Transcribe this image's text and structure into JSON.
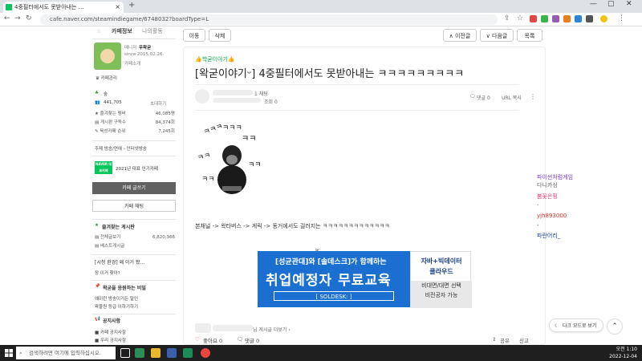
{
  "browser": {
    "tab_title": "4중필터에서도 못받아내는 ...",
    "new_tab": "+",
    "url": "cafe.naver.com/steamindiegame/6748032?boardType=L"
  },
  "sidebar": {
    "tab_info": "카페정보",
    "tab_activity": "나의활동",
    "manager_label": "매니저",
    "manager_name": "우왁굳",
    "since": "since 2015.02.26.",
    "intro": "카페소개",
    "ranks": "♛ 카페관리",
    "grade": "숲",
    "members": "441,705",
    "invite": "초대하기",
    "stats": [
      {
        "label": "★ 즐겨찾는 멤버",
        "value": "46,085명"
      },
      {
        "label": "▤ 게시판 구독수",
        "value": "84,374회"
      },
      {
        "label": "✎ 육성카페 순위",
        "value": "7,245회"
      }
    ],
    "topic": "주제  방송/연예 › 인터넷방송",
    "naver_badge": "NAVER 대표카페",
    "badge_text": "2021년 대표 인기카페",
    "write_btn": "카페 글쓰기",
    "chat_btn": "카페 채팅",
    "fav_head": "즐겨찾는 게시판",
    "fav_items": [
      {
        "label": "전체글보기",
        "value": "6,820,366"
      },
      {
        "label": "베스트게시글",
        "value": ""
      }
    ],
    "section1": "[시청 환경] 왜 이거 봤...",
    "section1_item": "장 이거 찾아?",
    "section2": "왁굳을 응원하는 비밀",
    "section2_items": [
      "왜이런 방송이거든 말인",
      "왁물원 등급 이하기하기"
    ],
    "notice_head": "공지사항",
    "notice_items": [
      "■ 카페 공지사항",
      "■ 우리 공지사항"
    ]
  },
  "main": {
    "btn_move": "이동",
    "btn_delete": "삭제",
    "btn_prev": "∧ 이전글",
    "btn_next": "∨ 다음글",
    "btn_list": "목록",
    "board_name": "👍학굳이야기👍",
    "title": "[왁굳이야기ᵕ] 4중필터에서도 못받아내는 ㅋㅋㅋㅋㅋㅋㅋㅋㅋ",
    "author_suffix": "1 채팅",
    "views": "조회 0",
    "comments": "댓글 0",
    "url_copy": "URL 복사",
    "body": "본채널 -> 왁타버스 -> 게릭 -> 동거에서도 걸러지는 ㅋㅋㅋㅋㅋㅋㅋㅋㅋㅋㅋㅋㅋ",
    "ad_line1": "[성균관대]와 [솔데스크]가 함께하는",
    "ad_line2": "취업예정자 무료교육",
    "ad_line3": "[ SOLDESK: ]",
    "ad_r1": "자바+빅데이터",
    "ad_r2": "클라우드",
    "ad_r3": "비대면/대면 선택",
    "ad_r4": "비전공자 가능",
    "author_other": "님 게시글 더보기 ›",
    "like": "좋아요 0",
    "comment_count": "댓글 0",
    "share": "공유",
    "report": "신고"
  },
  "chat": [
    {
      "text": "파이썬처럼게임",
      "color": "#7a3fd0"
    },
    {
      "text": "다니카싱",
      "color": "#666666"
    },
    {
      "text": "봄꽃은핑",
      "color": "#e63a6e"
    },
    {
      "text": "·",
      "color": "#444444"
    },
    {
      "text": "yjh893000",
      "color": "#d63030"
    },
    {
      "text": "-",
      "color": "#444444"
    },
    {
      "text": "파란어리_",
      "color": "#1e3fae"
    }
  ],
  "float": {
    "dark_mode": "다크 모드로 보기",
    "top": "⌃"
  },
  "taskbar": {
    "search": "검색하려면 여기에 입력하십시오.",
    "time": "오전 1:10",
    "date": "2022-12-04"
  }
}
